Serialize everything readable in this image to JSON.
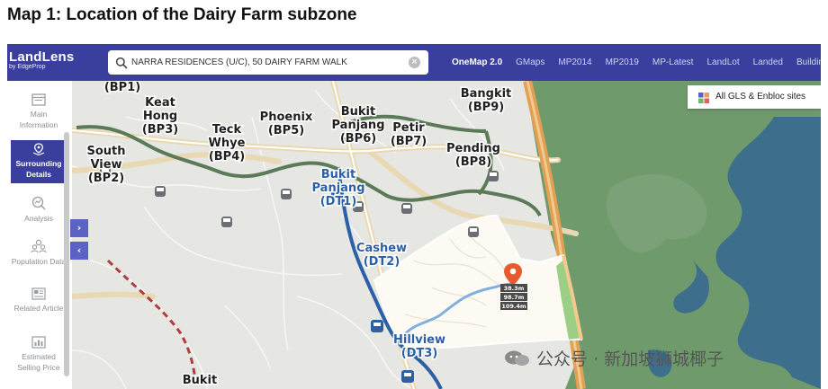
{
  "page_title": "Map 1: Location of the Dairy Farm subzone",
  "app": {
    "name": "LandLens",
    "byline": "by EdgeProp"
  },
  "search": {
    "value": "NARRA RESIDENCES (U/C), 50 DAIRY FARM WALK"
  },
  "tabs": [
    {
      "label": "OneMap 2.0",
      "active": true
    },
    {
      "label": "GMaps"
    },
    {
      "label": "MP2014"
    },
    {
      "label": "MP2019"
    },
    {
      "label": "MP-Latest"
    },
    {
      "label": "LandLot"
    },
    {
      "label": "Landed"
    },
    {
      "label": "Buildin"
    }
  ],
  "sidebar": {
    "items": [
      {
        "label": "Main Information",
        "icon": "window-icon"
      },
      {
        "label": "Surrounding Details",
        "icon": "pin-layers-icon",
        "active": true
      },
      {
        "label": "Analysis",
        "icon": "chart-magnifier-icon"
      },
      {
        "label": "Population Data",
        "icon": "people-icon"
      },
      {
        "label": "Related Article",
        "icon": "newspaper-icon"
      },
      {
        "label": "Estimated Selling Price",
        "icon": "bar-chart-icon"
      }
    ]
  },
  "panel_buttons": {
    "expand": "›",
    "collapse": "‹"
  },
  "gls_button": {
    "label": "All GLS & Enbloc sites"
  },
  "map": {
    "stations": [
      {
        "line1": "(BP1)"
      },
      {
        "line1": "Keat",
        "line2": "Hong",
        "line3": "(BP3)"
      },
      {
        "line1": "Teck",
        "line2": "Whye",
        "line3": "(BP4)"
      },
      {
        "line1": "Phoenix",
        "line2": "(BP5)"
      },
      {
        "line1": "Bukit",
        "line2": "Panjang",
        "line3": "(BP6)"
      },
      {
        "line1": "Petir",
        "line2": "(BP7)"
      },
      {
        "line1": "Bangkit",
        "line2": "(BP9)"
      },
      {
        "line1": "Pending",
        "line2": "(BP8)"
      },
      {
        "line1": "South",
        "line2": "View",
        "line3": "(BP2)"
      },
      {
        "line1": "Bukit",
        "line2": "Panjang",
        "line3": "(DT1)"
      },
      {
        "line1": "Cashew",
        "line2": "(DT2)"
      },
      {
        "line1": "Hillview",
        "line2": "(DT3)"
      },
      {
        "line1": "Bukit"
      }
    ],
    "distances": [
      "38.3m",
      "98.7m",
      "109.4m"
    ],
    "colors": {
      "lrt_line": "#5a7a58",
      "dtl_line": "#2b5fa6",
      "expressway": "#e2a055",
      "park": "#6f9a6c",
      "reservoir": "#3d6f8d",
      "highlight_zone": "#fdfaf3",
      "pin": "#e85a2c",
      "header": "#3a3f9e"
    }
  },
  "watermark": "公众号 · 新加坡狮城椰子"
}
